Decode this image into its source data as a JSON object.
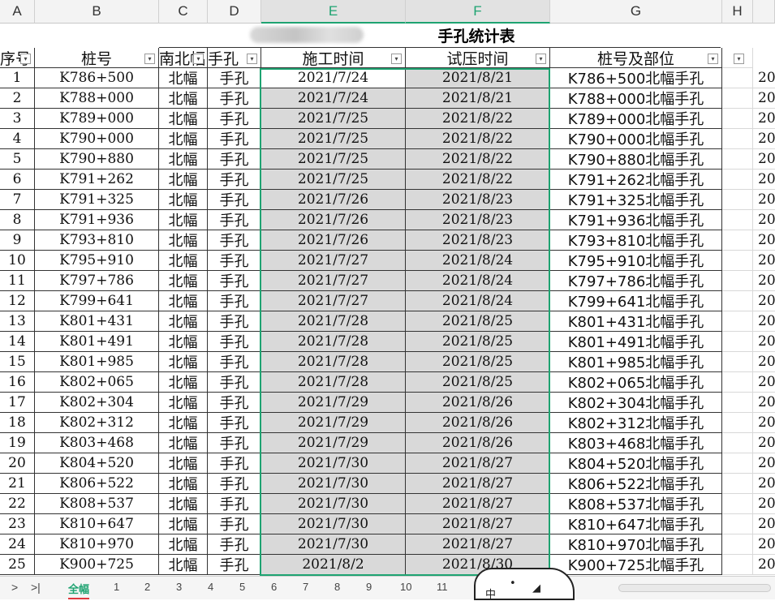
{
  "columns": [
    "A",
    "B",
    "C",
    "D",
    "E",
    "F",
    "G",
    "H"
  ],
  "title": "手孔统计表",
  "headers": [
    "序号",
    "桩号",
    "南北幅",
    "手孔",
    "施工时间",
    "试压时间",
    "桩号及部位"
  ],
  "h_col_partial": "20",
  "rows": [
    [
      "1",
      "K786+500",
      "北幅",
      "手孔",
      "2021/7/24",
      "2021/8/21",
      "K786+500北幅手孔"
    ],
    [
      "2",
      "K788+000",
      "北幅",
      "手孔",
      "2021/7/24",
      "2021/8/21",
      "K788+000北幅手孔"
    ],
    [
      "3",
      "K789+000",
      "北幅",
      "手孔",
      "2021/7/25",
      "2021/8/22",
      "K789+000北幅手孔"
    ],
    [
      "4",
      "K790+000",
      "北幅",
      "手孔",
      "2021/7/25",
      "2021/8/22",
      "K790+000北幅手孔"
    ],
    [
      "5",
      "K790+880",
      "北幅",
      "手孔",
      "2021/7/25",
      "2021/8/22",
      "K790+880北幅手孔"
    ],
    [
      "6",
      "K791+262",
      "北幅",
      "手孔",
      "2021/7/25",
      "2021/8/22",
      "K791+262北幅手孔"
    ],
    [
      "7",
      "K791+325",
      "北幅",
      "手孔",
      "2021/7/26",
      "2021/8/23",
      "K791+325北幅手孔"
    ],
    [
      "8",
      "K791+936",
      "北幅",
      "手孔",
      "2021/7/26",
      "2021/8/23",
      "K791+936北幅手孔"
    ],
    [
      "9",
      "K793+810",
      "北幅",
      "手孔",
      "2021/7/26",
      "2021/8/23",
      "K793+810北幅手孔"
    ],
    [
      "10",
      "K795+910",
      "北幅",
      "手孔",
      "2021/7/27",
      "2021/8/24",
      "K795+910北幅手孔"
    ],
    [
      "11",
      "K797+786",
      "北幅",
      "手孔",
      "2021/7/27",
      "2021/8/24",
      "K797+786北幅手孔"
    ],
    [
      "12",
      "K799+641",
      "北幅",
      "手孔",
      "2021/7/27",
      "2021/8/24",
      "K799+641北幅手孔"
    ],
    [
      "13",
      "K801+431",
      "北幅",
      "手孔",
      "2021/7/28",
      "2021/8/25",
      "K801+431北幅手孔"
    ],
    [
      "14",
      "K801+491",
      "北幅",
      "手孔",
      "2021/7/28",
      "2021/8/25",
      "K801+491北幅手孔"
    ],
    [
      "15",
      "K801+985",
      "北幅",
      "手孔",
      "2021/7/28",
      "2021/8/25",
      "K801+985北幅手孔"
    ],
    [
      "16",
      "K802+065",
      "北幅",
      "手孔",
      "2021/7/28",
      "2021/8/25",
      "K802+065北幅手孔"
    ],
    [
      "17",
      "K802+304",
      "北幅",
      "手孔",
      "2021/7/29",
      "2021/8/26",
      "K802+304北幅手孔"
    ],
    [
      "18",
      "K802+312",
      "北幅",
      "手孔",
      "2021/7/29",
      "2021/8/26",
      "K802+312北幅手孔"
    ],
    [
      "19",
      "K803+468",
      "北幅",
      "手孔",
      "2021/7/29",
      "2021/8/26",
      "K803+468北幅手孔"
    ],
    [
      "20",
      "K804+520",
      "北幅",
      "手孔",
      "2021/7/30",
      "2021/8/27",
      "K804+520北幅手孔"
    ],
    [
      "21",
      "K806+522",
      "北幅",
      "手孔",
      "2021/7/30",
      "2021/8/27",
      "K806+522北幅手孔"
    ],
    [
      "22",
      "K808+537",
      "北幅",
      "手孔",
      "2021/7/30",
      "2021/8/27",
      "K808+537北幅手孔"
    ],
    [
      "23",
      "K810+647",
      "北幅",
      "手孔",
      "2021/7/30",
      "2021/8/27",
      "K810+647北幅手孔"
    ],
    [
      "24",
      "K810+970",
      "北幅",
      "手孔",
      "2021/7/30",
      "2021/8/27",
      "K810+970北幅手孔"
    ],
    [
      "25",
      "K900+725",
      "北幅",
      "手孔",
      "2021/8/2",
      "2021/8/30",
      "K900+725北幅手孔"
    ]
  ],
  "sheet_tabs": [
    "全幅",
    "1",
    "2",
    "3",
    "4",
    "5",
    "6",
    "7",
    "8",
    "9",
    "10",
    "11"
  ],
  "active_tab": "全幅",
  "nav": {
    "next": ">",
    "last": ">|"
  },
  "ime": {
    "lang": "中",
    "sym1": "•",
    "sym2": "◢"
  },
  "colors": {
    "accent": "#1ea371",
    "selection_fill": "#d9d9d9",
    "tab_underline": "#e0383e"
  }
}
